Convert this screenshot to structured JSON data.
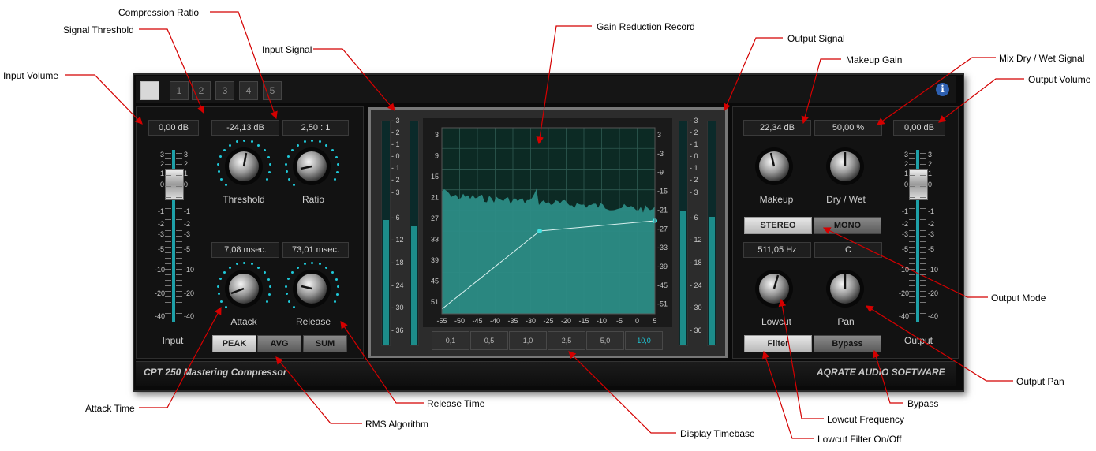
{
  "plugin": {
    "title": "CPT 250 Mastering Compressor",
    "vendor": "AQRATE AUDIO SOFTWARE",
    "presets": [
      "1",
      "2",
      "3",
      "4",
      "5"
    ],
    "info_icon": "info-icon"
  },
  "left": {
    "input_volume": "0,00 dB",
    "threshold_value": "-24,13 dB",
    "ratio_value": "2,50 : 1",
    "attack_value": "7,08 msec.",
    "release_value": "73,01 msec.",
    "threshold_label": "Threshold",
    "ratio_label": "Ratio",
    "attack_label": "Attack",
    "release_label": "Release",
    "input_label": "Input",
    "rms_modes": [
      "PEAK",
      "AVG",
      "SUM"
    ],
    "fader_scale": [
      "3",
      "2",
      "1",
      "0",
      "-1",
      "-2",
      "-3",
      "-5",
      "-10",
      "-20",
      "-40"
    ]
  },
  "middle": {
    "meter_scale": [
      "3",
      "2",
      "1",
      "0",
      "1",
      "2",
      "3",
      "6",
      "12",
      "18",
      "24",
      "30",
      "36"
    ],
    "graph_y_ticks": [
      "3",
      "9",
      "15",
      "21",
      "27",
      "33",
      "39",
      "45",
      "51"
    ],
    "graph_y_ticks_right": [
      "3",
      "-3",
      "-9",
      "-15",
      "-21",
      "-27",
      "-33",
      "-39",
      "-45",
      "-51"
    ],
    "graph_x_ticks": [
      "-55",
      "-50",
      "-45",
      "-40",
      "-35",
      "-30",
      "-25",
      "-20",
      "-15",
      "-10",
      "-5",
      "0",
      "5"
    ],
    "timebase": [
      "0,1",
      "0,5",
      "1,0",
      "2,5",
      "5,0",
      "10,0"
    ],
    "timebase_active": "10,0"
  },
  "right": {
    "makeup_value": "22,34 dB",
    "drywet_value": "50,00 %",
    "output_volume": "0,00 dB",
    "makeup_label": "Makeup",
    "drywet_label": "Dry / Wet",
    "stereo_label": "STEREO",
    "mono_label": "MONO",
    "lowcut_value": "511,05 Hz",
    "pan_value": "C",
    "lowcut_label": "Lowcut",
    "pan_label": "Pan",
    "filter_label": "Filter",
    "bypass_label": "Bypass",
    "output_label": "Output"
  },
  "annotations": {
    "input_volume": "Input Volume",
    "signal_threshold": "Signal Threshold",
    "compression_ratio": "Compression Ratio",
    "input_signal": "Input Signal",
    "gain_reduction_record": "Gain Reduction Record",
    "output_signal": "Output Signal",
    "makeup_gain": "Makeup Gain",
    "mix_dry_wet": "Mix Dry / Wet Signal",
    "output_volume": "Output Volume",
    "output_mode": "Output Mode",
    "output_pan": "Output Pan",
    "bypass": "Bypass",
    "lowcut_frequency": "Lowcut Frequency",
    "lowcut_filter_onoff": "Lowcut Filter On/Off",
    "display_timebase": "Display Timebase",
    "release_time": "Release Time",
    "rms_algorithm": "RMS Algorithm",
    "attack_time": "Attack Time"
  },
  "colors": {
    "accent": "#1ea0a8",
    "annotation_line": "#d40000",
    "graph_bg": "#0c2a24",
    "graph_fill": "#2c8c86"
  }
}
